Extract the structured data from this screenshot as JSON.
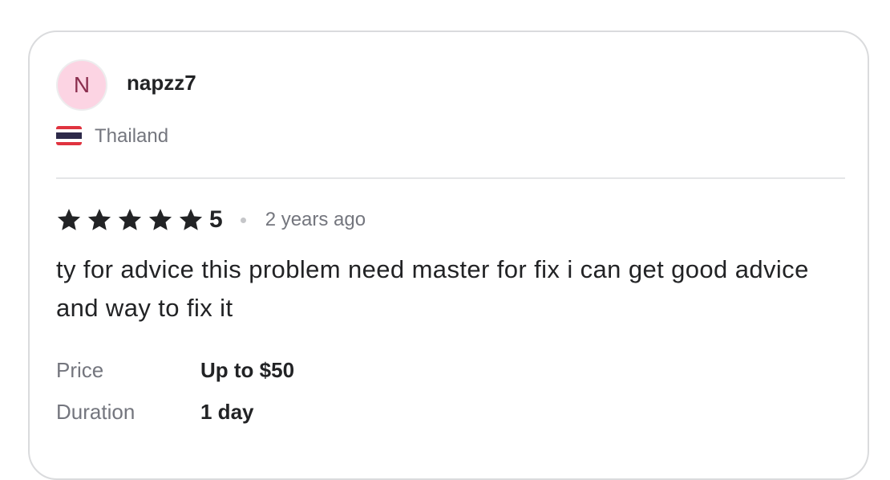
{
  "reviewer": {
    "avatar_initial": "N",
    "username": "napzz7",
    "country": "Thailand",
    "flag_icon": "thailand-flag-icon",
    "avatar_color": "#fcd4e3"
  },
  "review": {
    "rating": "5",
    "stars_filled": 5,
    "stars_total": 5,
    "time_ago": "2 years ago",
    "text": "ty for advice this problem need master for fix i can get good advice and way to fix it"
  },
  "details": {
    "price_label": "Price",
    "price_value": "Up to $50",
    "duration_label": "Duration",
    "duration_value": "1 day"
  }
}
